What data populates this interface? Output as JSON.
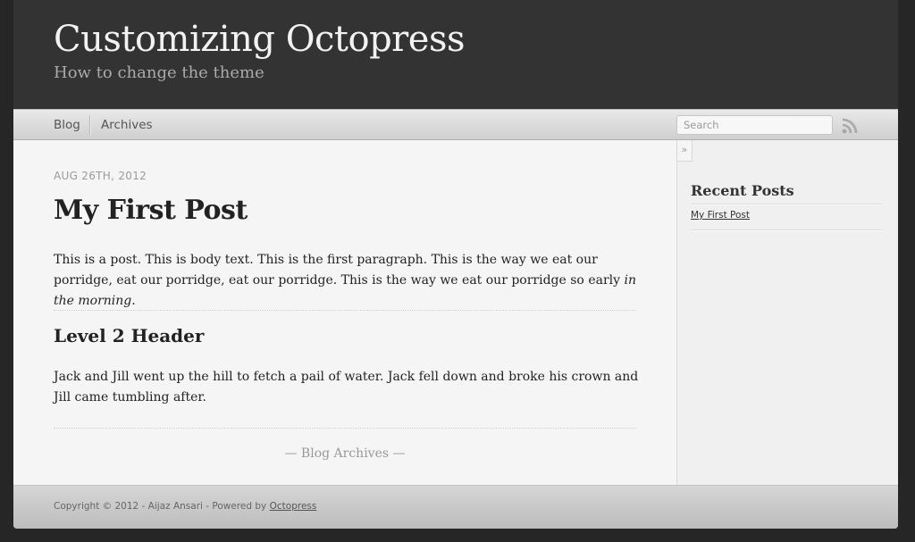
{
  "header": {
    "title": "Customizing Octopress",
    "subtitle": "How to change the theme"
  },
  "nav": {
    "items": [
      {
        "label": "Blog"
      },
      {
        "label": "Archives"
      }
    ],
    "search": {
      "placeholder": "Search",
      "value": ""
    },
    "rss_icon": "rss-icon"
  },
  "post": {
    "date": "AUG 26TH, 2012",
    "title": "My First Post",
    "paragraph_1": "This is a post. This is body text. This is the first paragraph. This is the way we eat our porridge, eat our porridge, eat our porridge. This is the way we eat our porridge so early ",
    "paragraph_1_emphasis": "in the morning",
    "paragraph_1_end": ".",
    "heading_2": "Level 2 Header",
    "paragraph_2": "Jack and Jill went up the hill to fetch a pail of water. Jack fell down and broke his crown and Jill came tumbling after."
  },
  "archives_link": "— Blog Archives —",
  "sidebar": {
    "toggle": "»",
    "recent_title": "Recent Posts",
    "recent_posts": [
      {
        "label": "My First Post"
      }
    ]
  },
  "footer": {
    "text": "Copyright © 2012 - Aijaz Ansari - Powered by ",
    "link": "Octopress"
  },
  "colors": {
    "header_bg": "#333333",
    "outer_bg": "#262626",
    "content_bg": "#f5f5f5"
  }
}
